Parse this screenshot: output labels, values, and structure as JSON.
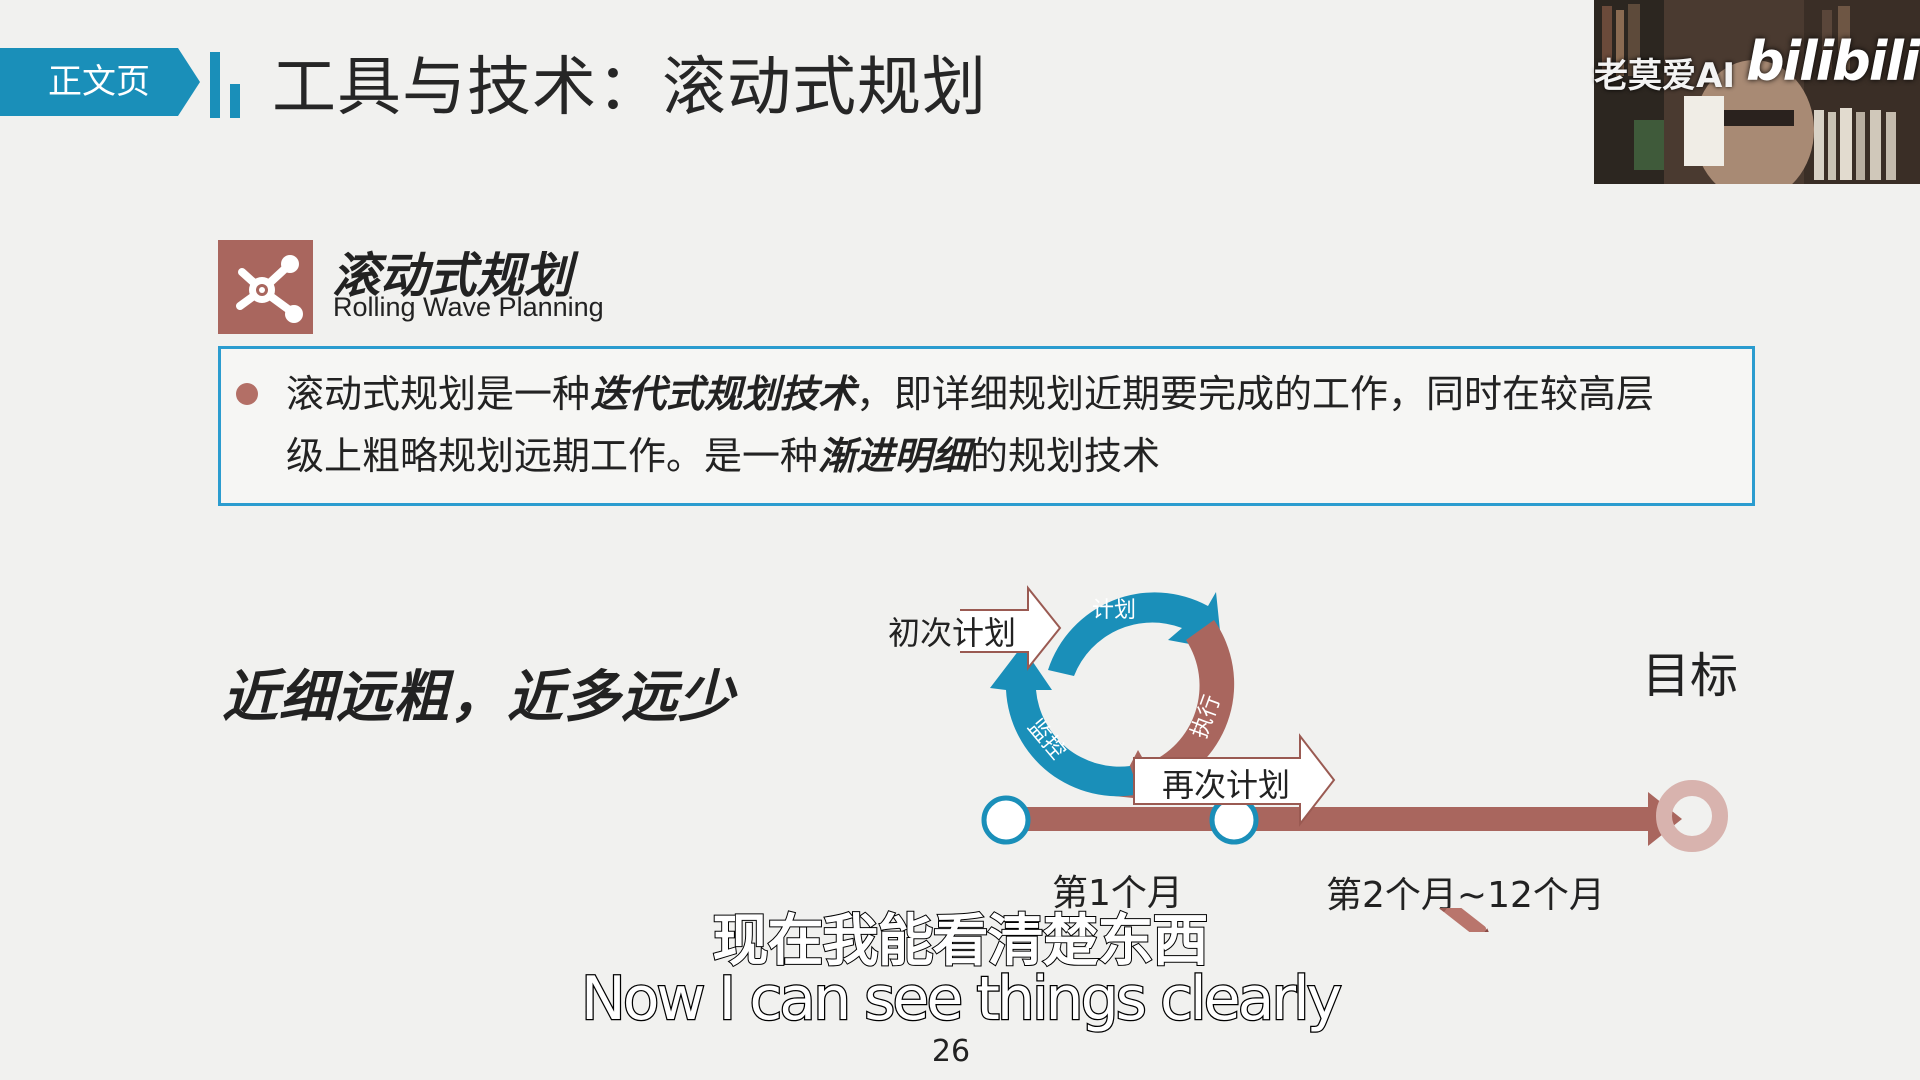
{
  "header": {
    "tag_label": "正文页",
    "title": "工具与技术：滚动式规划"
  },
  "webcam": {
    "name": "老莫爱AI",
    "logo": "bilibili"
  },
  "section": {
    "title": "滚动式规划",
    "subtitle": "Rolling Wave Planning",
    "icon": "network-icon"
  },
  "definition": {
    "part1": "滚动式规划是一种",
    "emph1": "迭代式规划技术",
    "part2": "，即详细规划近期要完成的工作，同时在较高层",
    "part3": "级上粗略规划远期工作。是一种",
    "emph2": "渐进明细",
    "part4": "的规划技术"
  },
  "slogan": "近细远粗，近多远少",
  "diagram": {
    "cycle_plan": "计划",
    "cycle_execute": "执行",
    "cycle_monitor": "监控",
    "initial_plan": "初次计划",
    "replan": "再次计划",
    "goal": "目标",
    "month1": "第1个月",
    "month2_12": "第2个月~12个月",
    "colors": {
      "blue": "#1a8fb9",
      "brown": "#a9665e"
    }
  },
  "subtitles": {
    "chinese": "现在我能看清楚东西",
    "english": "Now I can see things clearly"
  },
  "page_number": "26"
}
